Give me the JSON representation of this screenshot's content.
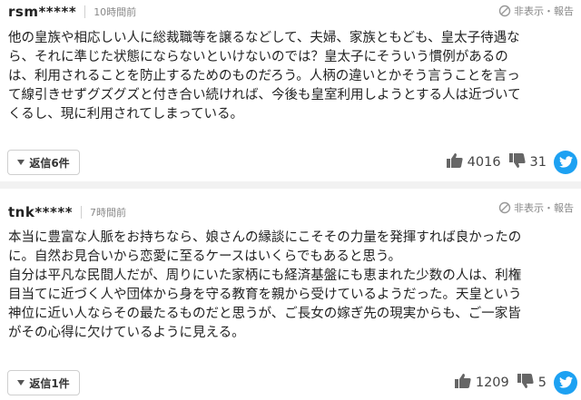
{
  "comments": [
    {
      "user": "rsm*****",
      "time": "10時間前",
      "hide_label": "非表示・報告",
      "lines": [
        "他の皇族や相応しい人に総裁職等を譲るなどして、夫婦、家族ともども、皇太子待遇な",
        "ら、それに準じた状態にならないといけないのでは？皇太子にそういう慣例があるの",
        "は、利用されることを防止するためのものだろう。人柄の違いとかそう言うことを言っ",
        "て線引きせずグズグズと付き合い続ければ、今後も皇室利用しようとする人は近づいて",
        "くるし、現に利用されてしまっている。"
      ],
      "reply_label": "返信6件",
      "likes": "4016",
      "dislikes": "31"
    },
    {
      "user": "tnk*****",
      "time": "7時間前",
      "hide_label": "非表示・報告",
      "lines": [
        "本当に豊富な人脈をお持ちなら、娘さんの縁談にこそその力量を発揮すれば良かったの",
        "に。自然お見合いから恋愛に至るケースはいくらでもあると思う。",
        "自分は平凡な民間人だが、周りにいた家柄にも経済基盤にも恵まれた少数の人は、利権",
        "目当てに近づく人や団体から身を守る教育を親から受けているようだった。天皇という",
        "神位に近い人ならその最たるものだと思うが、ご長女の嫁ぎ先の現実からも、ご一家皆",
        "がその心得に欠けているように見える。"
      ],
      "reply_label": "返信1件",
      "likes": "1209",
      "dislikes": "5"
    }
  ],
  "colors": {
    "twitter": "#1da1f2",
    "divider": "#f2f2f2",
    "meta": "#888888"
  },
  "icons": [
    "hide-icon",
    "thumbs-up-icon",
    "thumbs-down-icon",
    "twitter-icon",
    "reply-caret-icon"
  ]
}
